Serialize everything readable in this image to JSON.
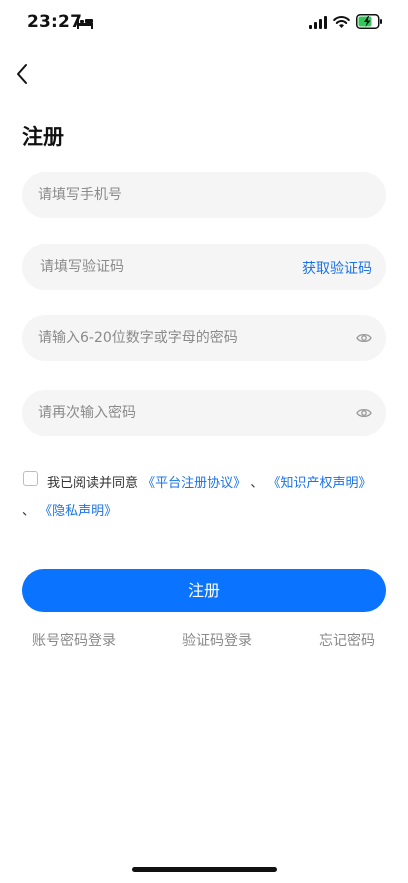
{
  "status_bar": {
    "time": "23:27"
  },
  "page": {
    "title": "注册"
  },
  "form": {
    "phone_placeholder": "请填写手机号",
    "code_placeholder": "请填写验证码",
    "get_code_label": "获取验证码",
    "password_placeholder": "请输入6-20位数字或字母的密码",
    "confirm_password_placeholder": "请再次输入密码"
  },
  "agreement": {
    "checked": false,
    "prefix": "我已阅读并同意",
    "platform_agreement": "《平台注册协议》",
    "separator1": "、",
    "ip_statement": "《知识产权声明》",
    "separator2": "、",
    "privacy_statement": "《隐私声明》"
  },
  "actions": {
    "register_label": "注册",
    "account_login_label": "账号密码登录",
    "code_login_label": "验证码登录",
    "forgot_password_label": "忘记密码"
  },
  "colors": {
    "primary": "#0a73ff",
    "link": "#1a73e8",
    "field_bg": "#f5f5f5",
    "muted_text": "#888888"
  }
}
